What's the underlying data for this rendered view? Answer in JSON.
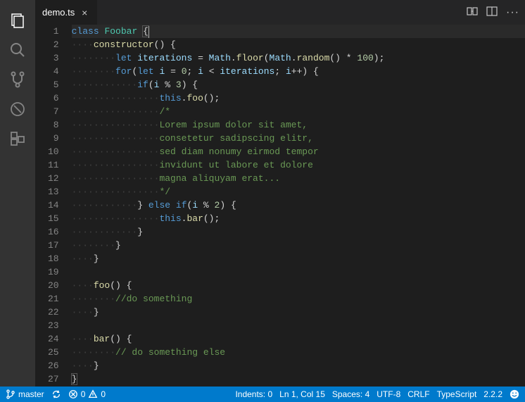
{
  "tab": {
    "filename": "demo.ts"
  },
  "gutter": {
    "lines": 27
  },
  "code": {
    "l1": {
      "kw1": "class",
      "ty": "Foobar",
      "br": "{"
    },
    "l2": {
      "fn": "constructor",
      "rest": "() {"
    },
    "l3": {
      "kw1": "let",
      "id1": "iterations",
      "eq": " = ",
      "obj": "Math",
      "dot1": ".",
      "m1": "floor",
      "p1": "(",
      "obj2": "Math",
      "dot2": ".",
      "m2": "random",
      "rest": "() * ",
      "num": "100",
      "end": ");"
    },
    "l4": {
      "kw1": "for",
      "p1": "(",
      "kw2": "let",
      "id1": "i",
      "eq": " = ",
      "n0": "0",
      "semi": "; ",
      "id2": "i",
      "lt": " < ",
      "id3": "iterations",
      "semi2": "; ",
      "id4": "i",
      "inc": "++) {"
    },
    "l5": {
      "kw1": "if",
      "p1": "(",
      "id1": "i",
      "mod": " % ",
      "n": "3",
      "rest": ") {"
    },
    "l6": {
      "th": "this",
      "dot": ".",
      "m": "foo",
      "rest": "();"
    },
    "l7": {
      "cm": "/*"
    },
    "l8": {
      "cm": "Lorem ipsum dolor sit amet,"
    },
    "l9": {
      "cm": "consetetur sadipscing elitr,"
    },
    "l10": {
      "cm": "sed diam nonumy eirmod tempor"
    },
    "l11": {
      "cm": "invidunt ut labore et dolore"
    },
    "l12": {
      "cm": "magna aliquyam erat..."
    },
    "l13": {
      "cm": "*/"
    },
    "l14": {
      "br1": "}",
      "sp": " ",
      "kw1": "else",
      "sp2": " ",
      "kw2": "if",
      "p1": "(",
      "id1": "i",
      "mod": " % ",
      "n": "2",
      "rest": ") {"
    },
    "l15": {
      "th": "this",
      "dot": ".",
      "m": "bar",
      "rest": "();"
    },
    "l16": {
      "br": "}"
    },
    "l17": {
      "br": "}"
    },
    "l18": {
      "br": "}"
    },
    "l20": {
      "fn": "foo",
      "rest": "() {"
    },
    "l21": {
      "cm": "//do something"
    },
    "l22": {
      "br": "}"
    },
    "l24": {
      "fn": "bar",
      "rest": "() {"
    },
    "l25": {
      "cm": "// do something else"
    },
    "l26": {
      "br": "}"
    },
    "l27": {
      "br": "}"
    }
  },
  "status": {
    "branch": "master",
    "errors": "0",
    "warnings": "0",
    "indents": "Indents: 0",
    "lncol": "Ln 1, Col 15",
    "spaces": "Spaces: 4",
    "encoding": "UTF-8",
    "eol": "CRLF",
    "language": "TypeScript",
    "version": "2.2.2"
  }
}
